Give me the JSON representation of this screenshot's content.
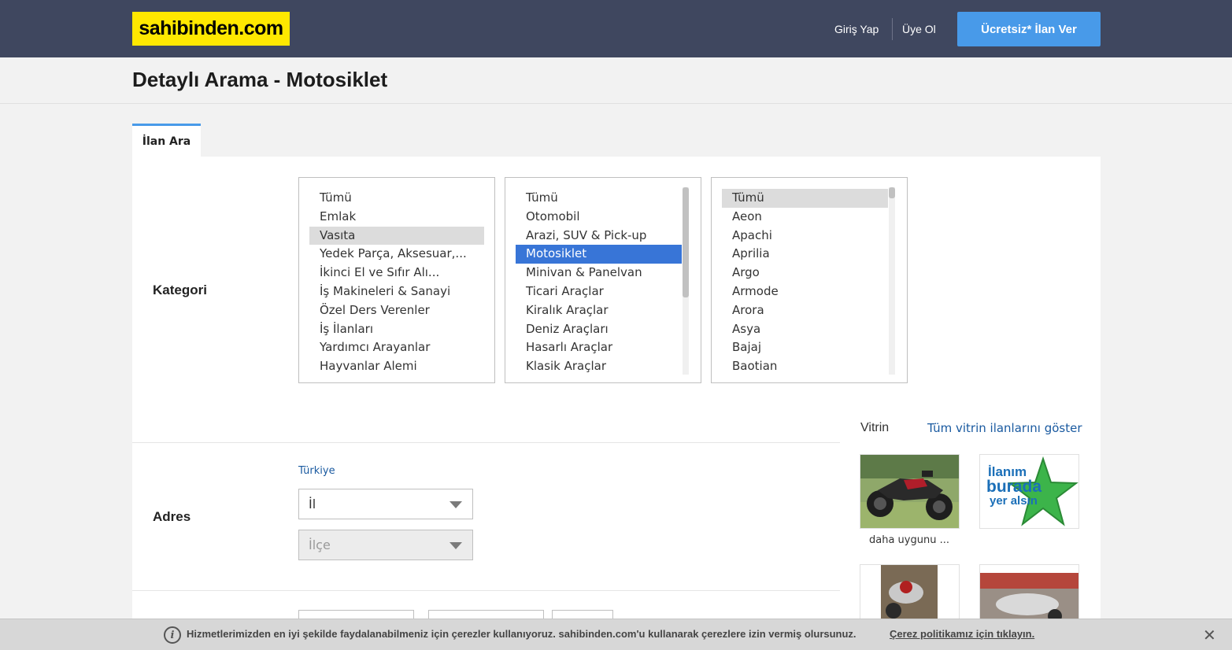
{
  "header": {
    "logo_text": "sahibinden.com",
    "login": "Giriş Yap",
    "register": "Üye Ol",
    "post_ad": "Ücretsiz* İlan Ver"
  },
  "page": {
    "title": "Detaylı Arama - Motosiklet",
    "tab": "İlan Ara"
  },
  "kategori": {
    "label": "Kategori",
    "list1": [
      "Tümü",
      "Emlak",
      "Vasıta",
      "Yedek Parça, Aksesuar,...",
      "İkinci El ve Sıfır Alı...",
      "İş Makineleri & Sanayi",
      "Özel Ders Verenler",
      "İş İlanları",
      "Yardımcı Arayanlar",
      "Hayvanlar Alemi"
    ],
    "list2": [
      "Tümü",
      "Otomobil",
      "Arazi, SUV & Pick-up",
      "Motosiklet",
      "Minivan & Panelvan",
      "Ticari Araçlar",
      "Kiralık Araçlar",
      "Deniz Araçları",
      "Hasarlı Araçlar",
      "Klasik Araçlar"
    ],
    "list3": [
      "Tümü",
      "Aeon",
      "Apachi",
      "Aprilia",
      "Argo",
      "Armode",
      "Arora",
      "Asya",
      "Bajaj",
      "Baotian"
    ]
  },
  "adres": {
    "label": "Adres",
    "country": "Türkiye",
    "il_placeholder": "İl",
    "ilce_placeholder": "İlçe"
  },
  "vitrin": {
    "title": "Vitrin",
    "show_all": "Tüm vitrin ilanlarını göster",
    "caption1": "daha uygunu ...",
    "promo_line1": "İlanım",
    "promo_line2": "burada",
    "promo_line3": "yer alsın"
  },
  "cookie": {
    "text": "Hizmetlerimizden en iyi şekilde faydalanabilmeniz için çerezler kullanıyoruz. sahibinden.com'u kullanarak çerezlere izin vermiş olursunuz.",
    "link": "Çerez politikamız için tıklayın.",
    "close": "✕"
  },
  "colors": {
    "header_bg": "#3f475f",
    "logo_bg": "#ffe800",
    "accent_blue": "#489ae9",
    "selection_blue": "#3875d7"
  }
}
